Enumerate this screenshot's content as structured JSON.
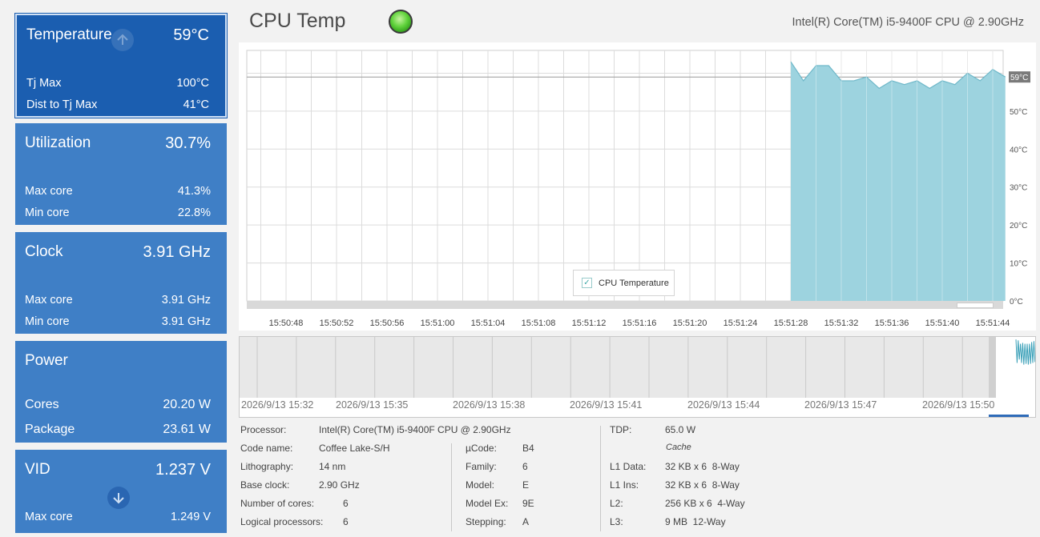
{
  "tiles": {
    "temperature": {
      "title": "Temperature",
      "value": "59°C",
      "rows": [
        {
          "label": "Tj Max",
          "value": "100°C"
        },
        {
          "label": "Dist to Tj Max",
          "value": "41°C"
        }
      ]
    },
    "utilization": {
      "title": "Utilization",
      "value": "30.7%",
      "rows": [
        {
          "label": "Max core",
          "value": "41.3%"
        },
        {
          "label": "Min core",
          "value": "22.8%"
        }
      ]
    },
    "clock": {
      "title": "Clock",
      "value": "3.91 GHz",
      "rows": [
        {
          "label": "Max core",
          "value": "3.91 GHz"
        },
        {
          "label": "Min core",
          "value": "3.91 GHz"
        }
      ]
    },
    "power": {
      "title": "Power",
      "rows": [
        {
          "label": "Cores",
          "value": "20.20 W"
        },
        {
          "label": "Package",
          "value": "23.61 W"
        }
      ]
    },
    "vid": {
      "title": "VID",
      "value": "1.237 V",
      "rows": [
        {
          "label": "Max core",
          "value": "1.249 V"
        }
      ]
    }
  },
  "header": {
    "title": "CPU Temp",
    "status_color": "#5fd23b",
    "cpu_name": "Intel(R) Core(TM) i5-9400F CPU @ 2.90GHz"
  },
  "chart_data": {
    "type": "area",
    "x_ticks": [
      "15:50:48",
      "15:50:52",
      "15:50:56",
      "15:51:00",
      "15:51:04",
      "15:51:08",
      "15:51:12",
      "15:51:16",
      "15:51:20",
      "15:51:24",
      "15:51:28",
      "15:51:32",
      "15:51:36",
      "15:51:40",
      "15:51:44"
    ],
    "y_ticks": [
      "0°C",
      "10°C",
      "20°C",
      "30°C",
      "40°C",
      "50°C"
    ],
    "ylim": [
      0,
      66
    ],
    "current_label": "59°C",
    "current_value": 59,
    "legend": "CPU Temperature",
    "series": [
      {
        "name": "CPU Temperature",
        "color": "#9dd3df",
        "x": [
          "15:51:28",
          "15:51:29",
          "15:51:30",
          "15:51:31",
          "15:51:32",
          "15:51:33",
          "15:51:34",
          "15:51:35",
          "15:51:36",
          "15:51:37",
          "15:51:38",
          "15:51:39",
          "15:51:40",
          "15:51:41",
          "15:51:42",
          "15:51:43",
          "15:51:44",
          "15:51:45"
        ],
        "values": [
          63,
          58,
          62,
          62,
          58,
          58,
          59,
          56,
          58,
          57,
          58,
          56,
          58,
          57,
          60,
          58,
          61,
          59
        ]
      }
    ]
  },
  "overview": {
    "labels": [
      "2026/9/13 15:32",
      "2026/9/13 15:35",
      "2026/9/13 15:38",
      "2026/9/13 15:41",
      "2026/9/13 15:44",
      "2026/9/13 15:47",
      "2026/9/13 15:50"
    ]
  },
  "info": {
    "col1": [
      {
        "label": "Processor:",
        "value": "Intel(R) Core(TM) i5-9400F CPU @ 2.90GHz"
      },
      {
        "label": "Code name:",
        "value": "Coffee Lake-S/H"
      },
      {
        "label": "Lithography:",
        "value": "14 nm"
      },
      {
        "label": "Base clock:",
        "value": "2.90 GHz"
      },
      {
        "label": "Number of cores:",
        "value": "6"
      },
      {
        "label": "Logical processors:",
        "value": "6"
      }
    ],
    "col2": [
      {
        "label": "µCode:",
        "value": "B4"
      },
      {
        "label": "Family:",
        "value": "6"
      },
      {
        "label": "Model:",
        "value": "E"
      },
      {
        "label": "Model Ex:",
        "value": "9E"
      },
      {
        "label": "Stepping:",
        "value": "A"
      }
    ],
    "tdp": {
      "label": "TDP:",
      "value": "65.0 W"
    },
    "cache_heading": "Cache",
    "cache": [
      {
        "label": "L1 Data:",
        "value": "32 KB x 6  8-Way"
      },
      {
        "label": "L1 Ins:",
        "value": "32 KB x 6  8-Way"
      },
      {
        "label": "L2:",
        "value": "256 KB x 6  4-Way"
      },
      {
        "label": "L3:",
        "value": "9 MB  12-Way"
      }
    ]
  }
}
